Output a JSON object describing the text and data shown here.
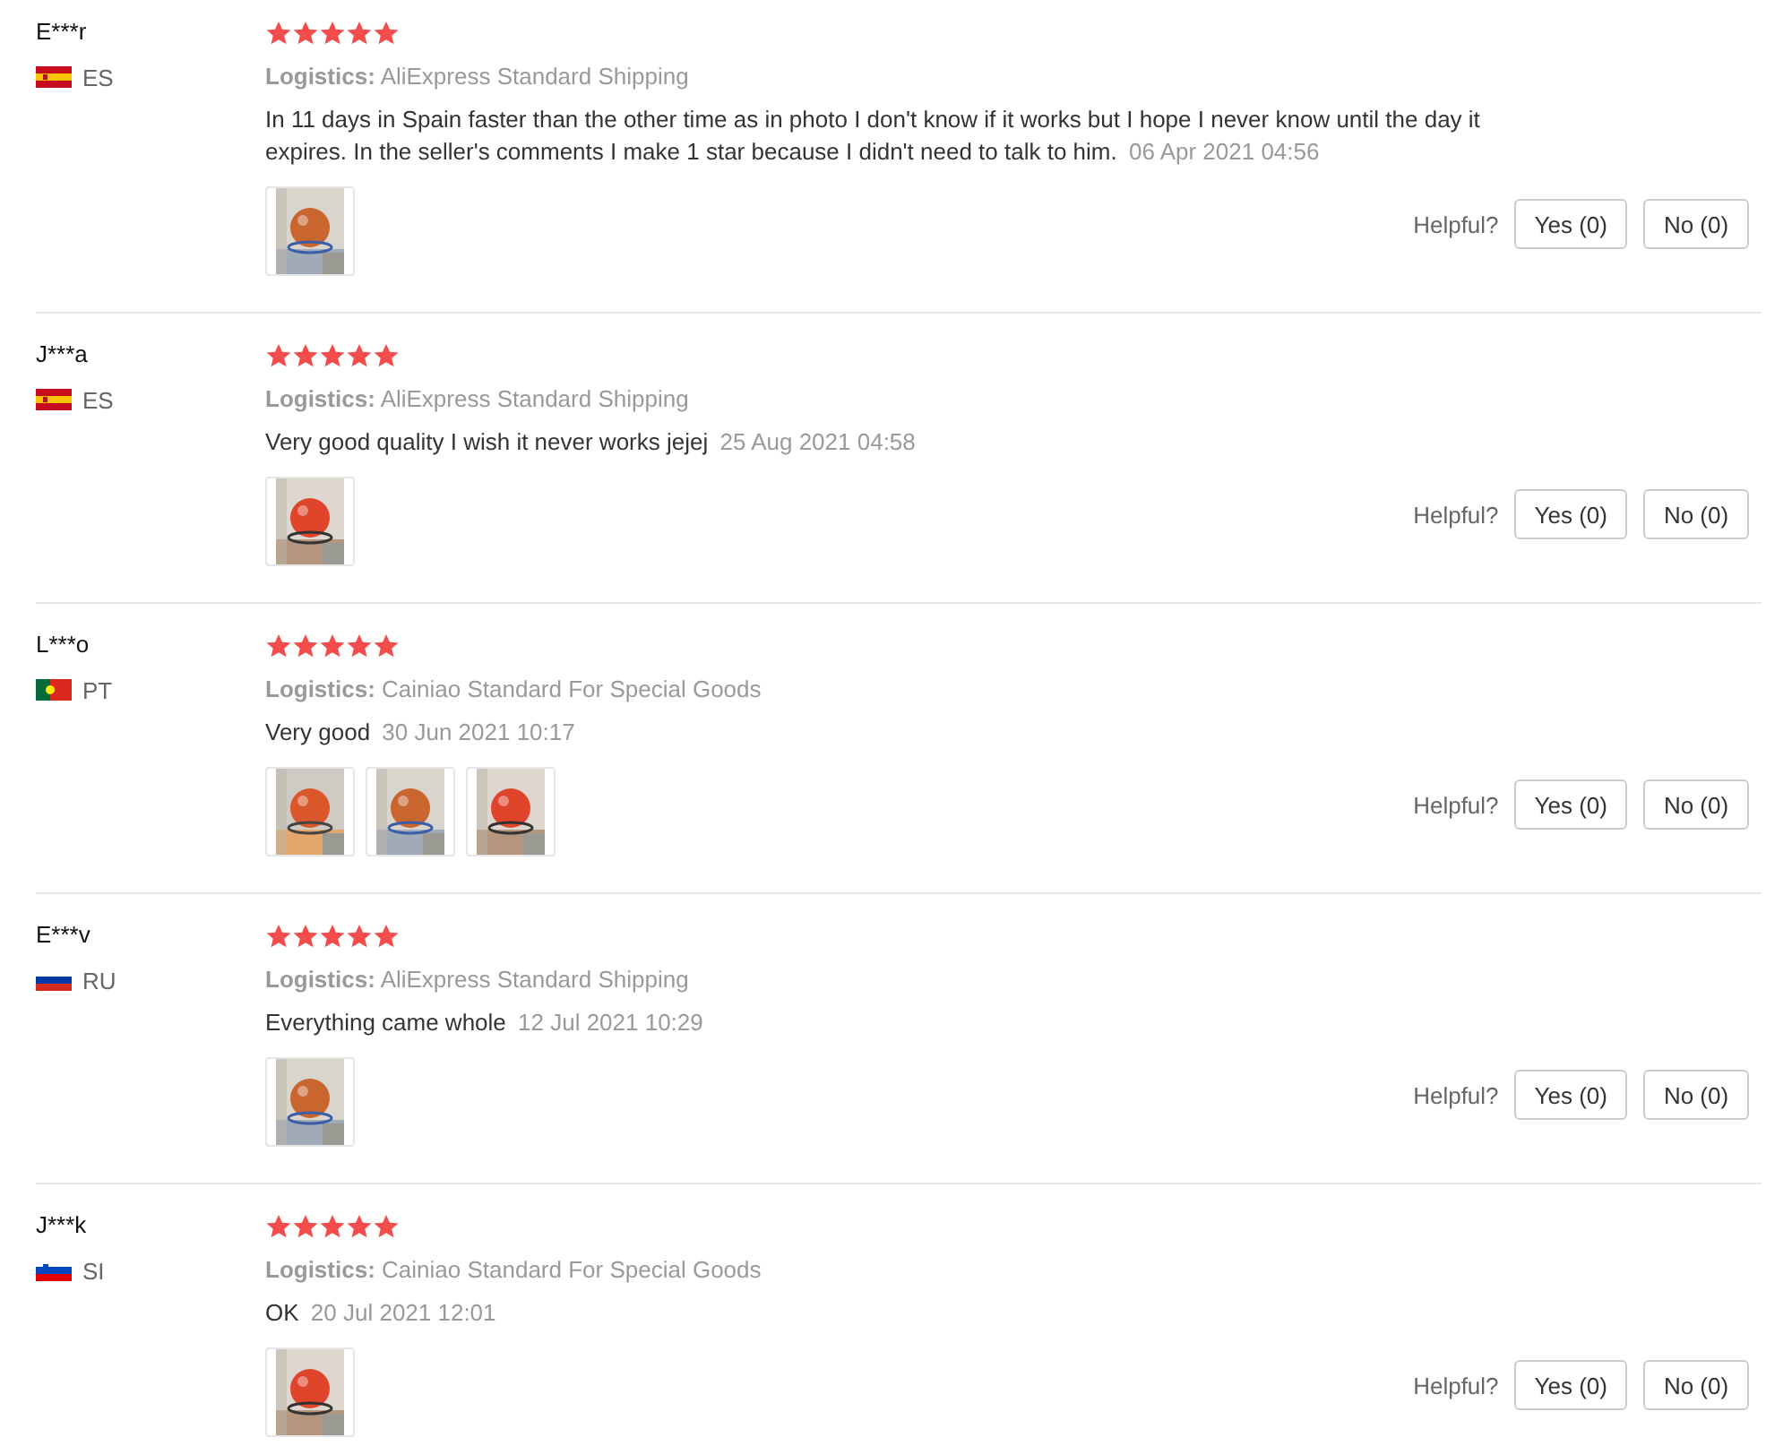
{
  "reviews": [
    {
      "name": "E***r",
      "flag": {
        "kind": "spain"
      },
      "country": "ES",
      "stars": 5,
      "logistics_label": "Logistics:",
      "logistics": "AliExpress Standard Shipping",
      "text": "In 11 days in Spain faster than the other time as in photo I don't know if it works but I hope I never know until the day it expires. In the seller's comments I make 1 star because I didn't need to talk to him.",
      "date": "06 Apr 2021 04:56",
      "photos": [
        {
          "kind": "picture"
        }
      ],
      "helpful_label": "Helpful?",
      "yes": "Yes (0)",
      "no": "No (0)"
    },
    {
      "name": "J***a",
      "flag": {
        "kind": "spain"
      },
      "country": "ES",
      "stars": 5,
      "logistics_label": "Logistics:",
      "logistics": "AliExpress Standard Shipping",
      "text": "Very good quality I wish it never works jejej",
      "date": "25 Aug 2021 04:58",
      "photos": [
        {
          "kind": "picture"
        }
      ],
      "helpful_label": "Helpful?",
      "yes": "Yes (0)",
      "no": "No (0)"
    },
    {
      "name": "L***o",
      "flag": {
        "kind": "portugal"
      },
      "country": "PT",
      "stars": 5,
      "logistics_label": "Logistics:",
      "logistics": "Cainiao Standard For Special Goods",
      "text": "Very good",
      "date": "30 Jun 2021 10:17",
      "photos": [
        {
          "kind": "picture"
        },
        {
          "kind": "picture"
        },
        {
          "kind": "picture"
        }
      ],
      "helpful_label": "Helpful?",
      "yes": "Yes (0)",
      "no": "No (0)"
    },
    {
      "name": "E***v",
      "flag": {
        "kind": "russia"
      },
      "country": "RU",
      "stars": 5,
      "logistics_label": "Logistics:",
      "logistics": "AliExpress Standard Shipping",
      "text": "Everything came whole",
      "date": "12 Jul 2021 10:29",
      "photos": [
        {
          "kind": "picture"
        }
      ],
      "helpful_label": "Helpful?",
      "yes": "Yes (0)",
      "no": "No (0)"
    },
    {
      "name": "J***k",
      "flag": {
        "kind": "slovenia"
      },
      "country": "SI",
      "stars": 5,
      "logistics_label": "Logistics:",
      "logistics": "Cainiao Standard For Special Goods",
      "text": "OK",
      "date": "20 Jul 2021 12:01",
      "photos": [
        {
          "kind": "picture"
        }
      ],
      "helpful_label": "Helpful?",
      "yes": "Yes (0)",
      "no": "No (0)"
    }
  ]
}
